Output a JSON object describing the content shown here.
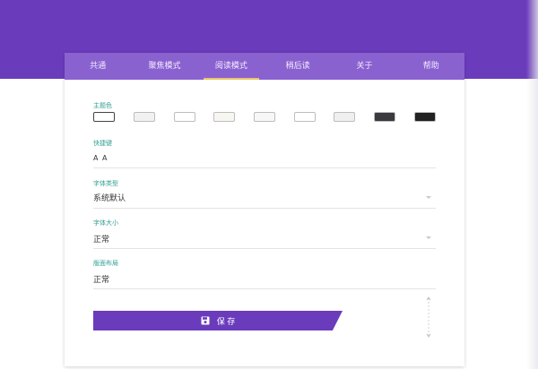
{
  "tabs": [
    {
      "label": "共通"
    },
    {
      "label": "聚焦模式"
    },
    {
      "label": "阅读模式",
      "active": true
    },
    {
      "label": "稍后读"
    },
    {
      "label": "关于"
    },
    {
      "label": "帮助"
    }
  ],
  "theme": {
    "label": "主题色",
    "swatches": [
      {
        "color": "#ffffff",
        "selected": true
      },
      {
        "color": "#f1f1f1"
      },
      {
        "color": "#ffffff"
      },
      {
        "color": "#f7f6f0"
      },
      {
        "color": "#f7f7f7"
      },
      {
        "color": "#ffffff"
      },
      {
        "color": "#efefef"
      },
      {
        "color": "#3a3b3f"
      },
      {
        "color": "#222222"
      }
    ]
  },
  "shortcut": {
    "label": "快捷键",
    "value": "A A"
  },
  "font_type": {
    "label": "字体类型",
    "value": "系统默认"
  },
  "font_size": {
    "label": "字体大小",
    "value": "正常"
  },
  "layout": {
    "label": "版面布局",
    "value": "正常"
  },
  "save": {
    "label": "保 存"
  },
  "colors": {
    "header": "#6a3cbc",
    "tabs": "#8a62d0",
    "accent_line": "#e9c46a",
    "label_text": "#2f9e92"
  }
}
